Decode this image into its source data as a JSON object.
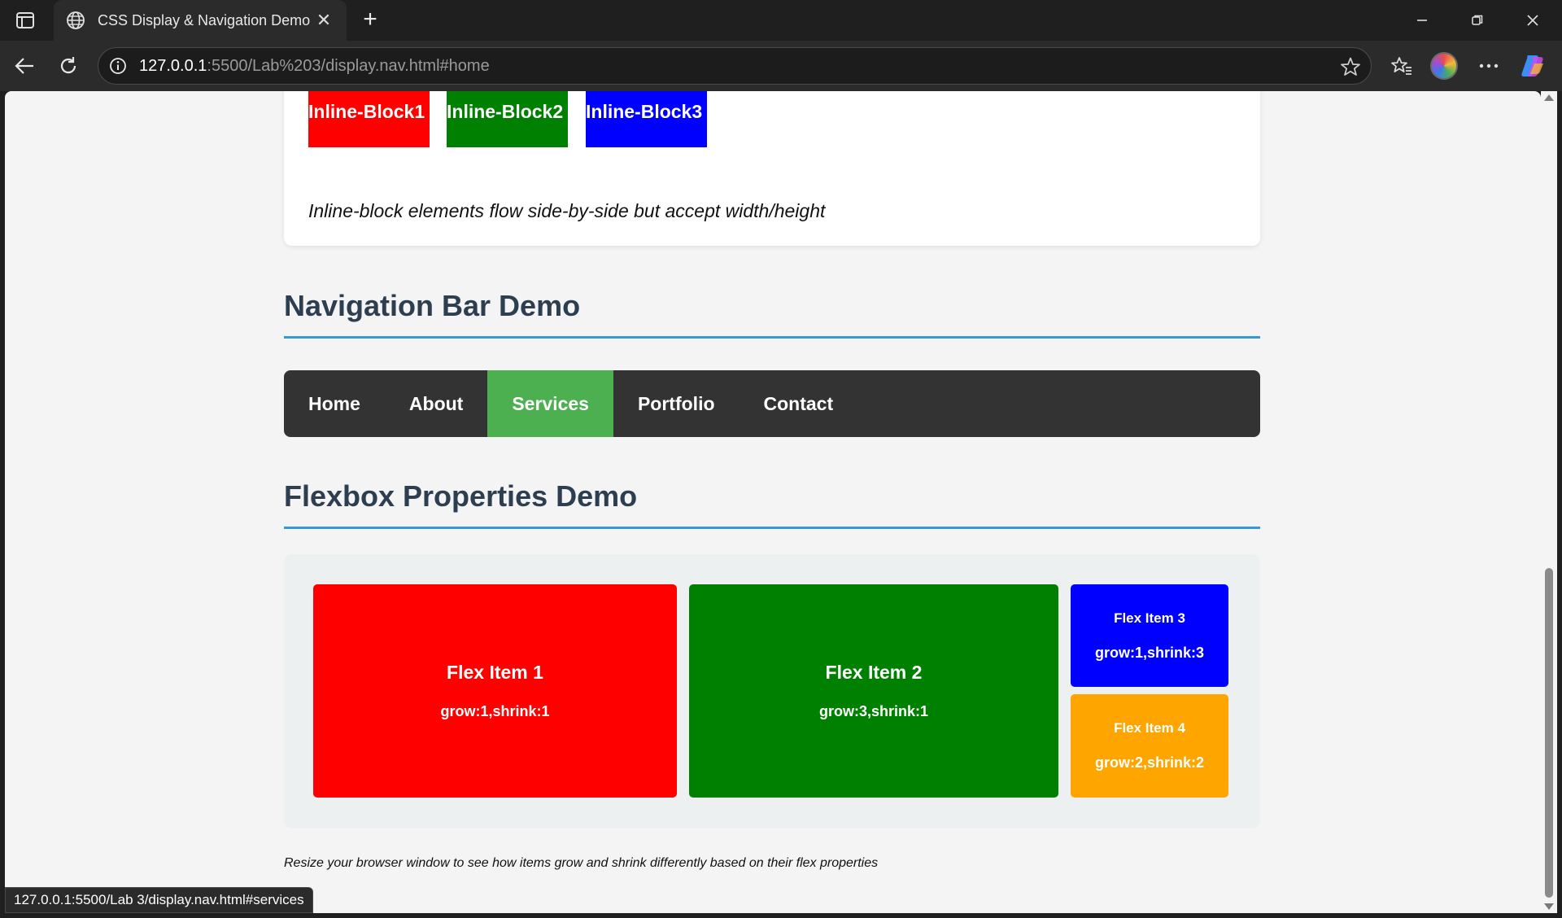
{
  "browser": {
    "tab_title": "CSS Display & Navigation Demo",
    "tab_close": "✕",
    "new_tab": "+",
    "url_host": "127.0.0.1",
    "url_rest": ":5500/Lab%203/display.nav.html#home",
    "status_url": "127.0.0.1:5500/Lab 3/display.nav.html#services"
  },
  "inline_blocks": [
    {
      "label": "Inline-Block1",
      "color": "#ff0000"
    },
    {
      "label": "Inline-Block2",
      "color": "#008000"
    },
    {
      "label": "Inline-Block3",
      "color": "#0000ff"
    }
  ],
  "inline_note": "Inline-block elements flow side-by-side but accept width/height",
  "nav_section": {
    "title": "Navigation Bar Demo",
    "links": [
      "Home",
      "About",
      "Services",
      "Portfolio",
      "Contact"
    ],
    "active": "Services",
    "bar_color": "#333333",
    "active_color": "#4caf50"
  },
  "flex_section": {
    "title": "Flexbox Properties Demo",
    "items": [
      {
        "title": "Flex Item 1",
        "sub": "grow:1,shrink:1",
        "color": "#ff0000"
      },
      {
        "title": "Flex Item 2",
        "sub": "grow:3,shrink:1",
        "color": "#008000"
      },
      {
        "title": "Flex Item 3",
        "sub": "grow:1,shrink:3",
        "color": "#0000ff"
      },
      {
        "title": "Flex Item 4",
        "sub": "grow:2,shrink:2",
        "color": "#ffa500"
      }
    ],
    "note": "Resize your browser window to see how items grow and shrink differently based on their flex properties"
  },
  "colors": {
    "heading": "#2c3e50",
    "heading_rule": "#3498db"
  }
}
